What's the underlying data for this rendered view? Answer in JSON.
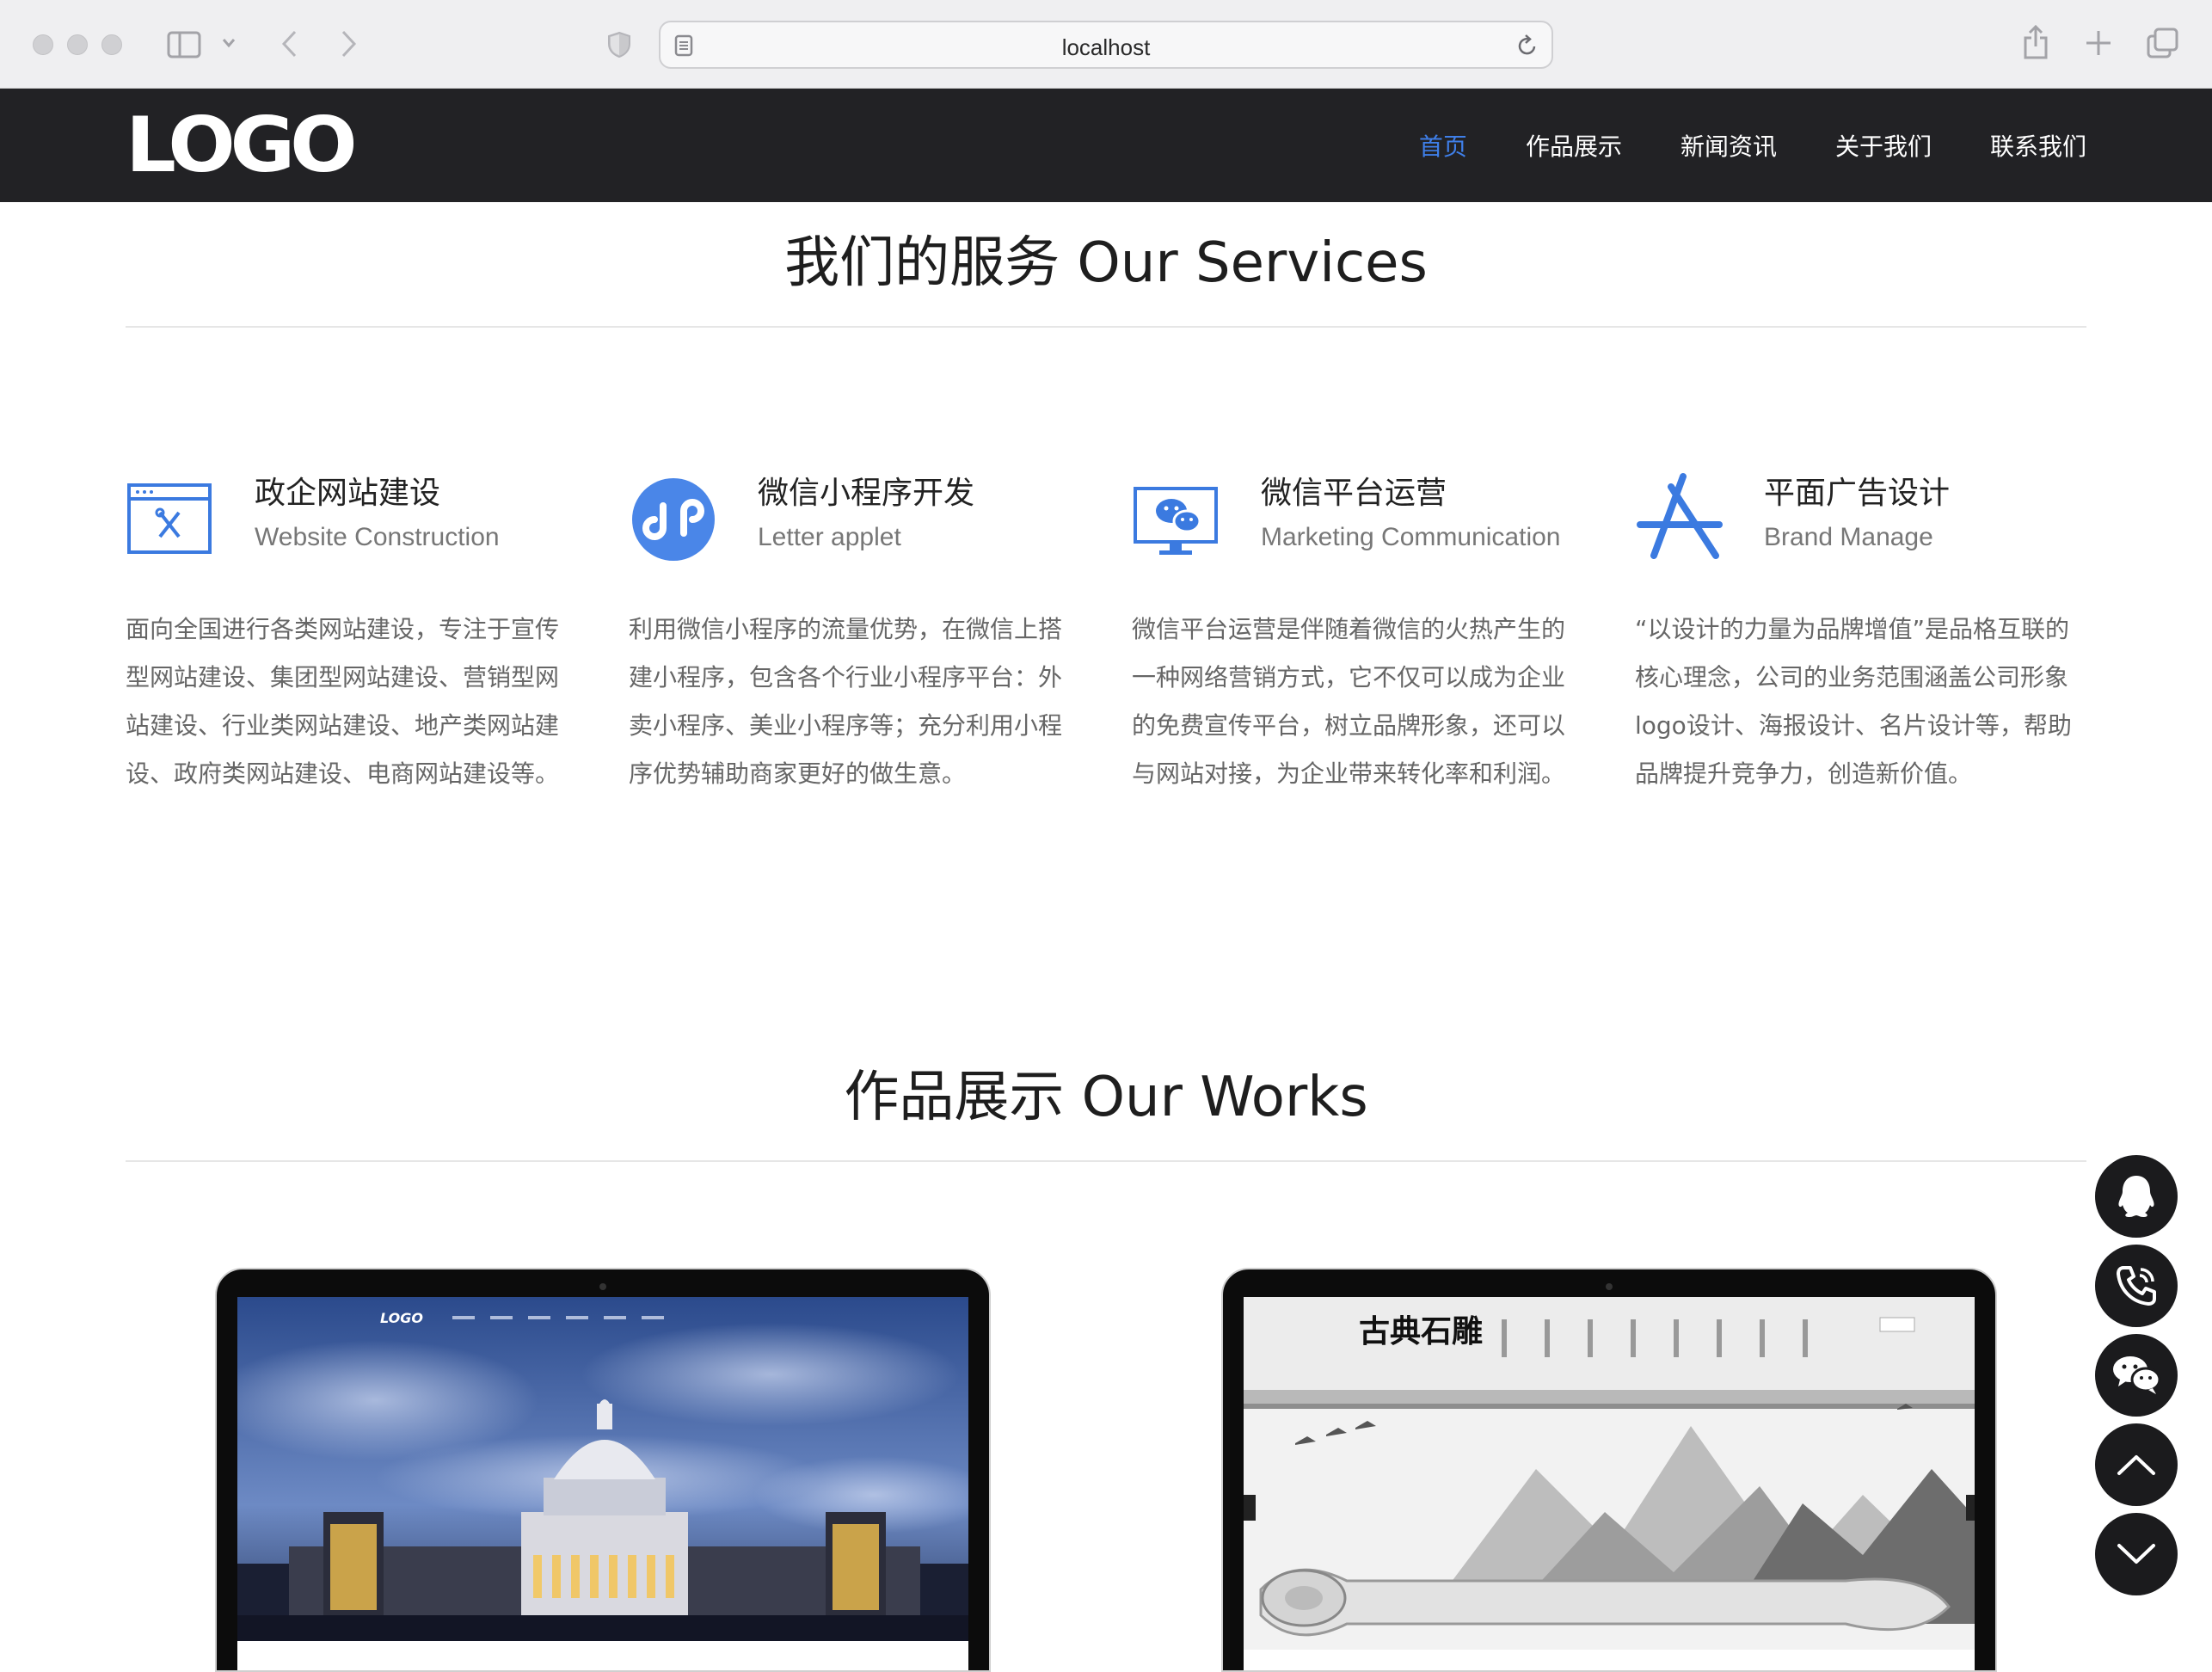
{
  "browser": {
    "url": "localhost"
  },
  "header": {
    "logo": "LOGO",
    "nav": [
      {
        "label": "首页",
        "active": true
      },
      {
        "label": "作品展示",
        "active": false
      },
      {
        "label": "新闻资讯",
        "active": false
      },
      {
        "label": "关于我们",
        "active": false
      },
      {
        "label": "联系我们",
        "active": false
      }
    ]
  },
  "services": {
    "title": "我们的服务 Our Services",
    "items": [
      {
        "title": "政企网站建设",
        "subtitle": "Website Construction",
        "icon": "website-icon",
        "desc": "面向全国进行各类网站建设，专注于宣传型网站建设、集团型网站建设、营销型网站建设、行业类网站建设、地产类网站建设、政府类网站建设、电商网站建设等。"
      },
      {
        "title": "微信小程序开发",
        "subtitle": "Letter applet",
        "icon": "mini-program-icon",
        "desc": "利用微信小程序的流量优势，在微信上搭建小程序，包含各个行业小程序平台：外卖小程序、美业小程序等；充分利用小程序优势辅助商家更好的做生意。"
      },
      {
        "title": "微信平台运营",
        "subtitle": "Marketing Communication",
        "icon": "wechat-monitor-icon",
        "desc": "微信平台运营是伴随着微信的火热产生的一种网络营销方式，它不仅可以成为企业的免费宣传平台，树立品牌形象，还可以与网站对接，为企业带来转化率和利润。"
      },
      {
        "title": "平面广告设计",
        "subtitle": "Brand Manage",
        "icon": "app-store-icon",
        "desc": "“以设计的力量为品牌增值”是品格互联的核心理念，公司的业务范围涵盖公司形象logo设计、海报设计、名片设计等，帮助品牌提升竞争力，创造新价值。"
      }
    ]
  },
  "works": {
    "title": "作品展示 Our Works",
    "items": [
      {
        "logo": "LOGO",
        "name": "capitol-night-site"
      },
      {
        "logo": "古典石雕",
        "name": "stone-carving-site"
      }
    ]
  },
  "sidebar_buttons": [
    {
      "icon": "qq-icon"
    },
    {
      "icon": "phone-icon"
    },
    {
      "icon": "wechat-icon"
    },
    {
      "icon": "scroll-up-icon"
    },
    {
      "icon": "scroll-down-icon"
    }
  ],
  "colors": {
    "header_bg": "#222225",
    "accent": "#3f7fe9",
    "icon_blue": "#3b7ae0"
  }
}
